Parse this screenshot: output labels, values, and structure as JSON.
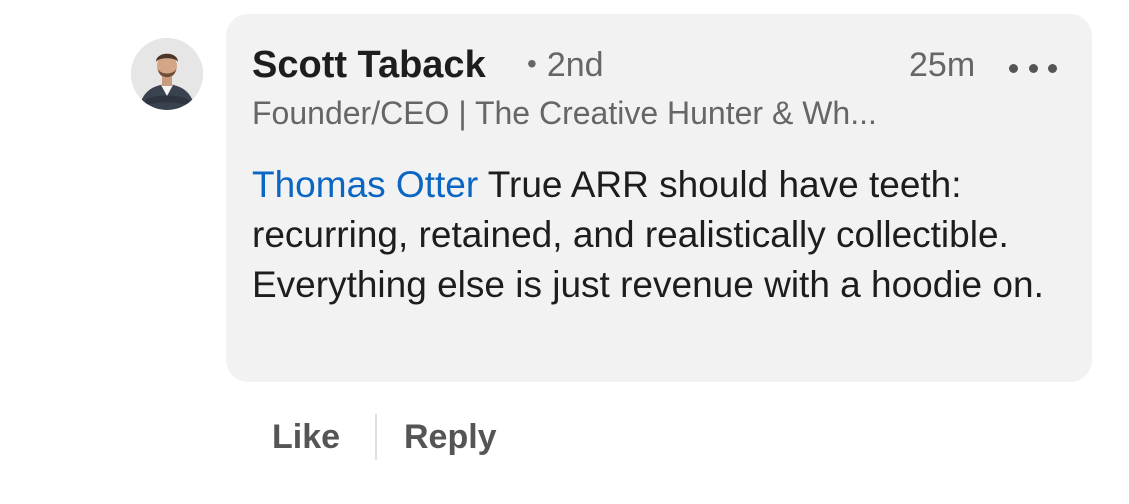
{
  "comment": {
    "author": {
      "name": "Scott Taback",
      "degree_separator": "•",
      "degree": "2nd",
      "headline": "Founder/CEO | The Creative Hunter & Wh...",
      "avatar": "profile-photo"
    },
    "timestamp": "25m",
    "more_icon": "ellipsis-icon",
    "mention": "Thomas Otter",
    "body": " True ARR should have teeth: recurring, retained, and realistically collectible. Everything else is just revenue with a hoodie on."
  },
  "actions": {
    "like_label": "Like",
    "reply_label": "Reply"
  },
  "colors": {
    "bubble_bg": "#f2f2f2",
    "mention": "#0a66c2",
    "primary_text": "#1d1d1d",
    "secondary_text": "#666666"
  }
}
